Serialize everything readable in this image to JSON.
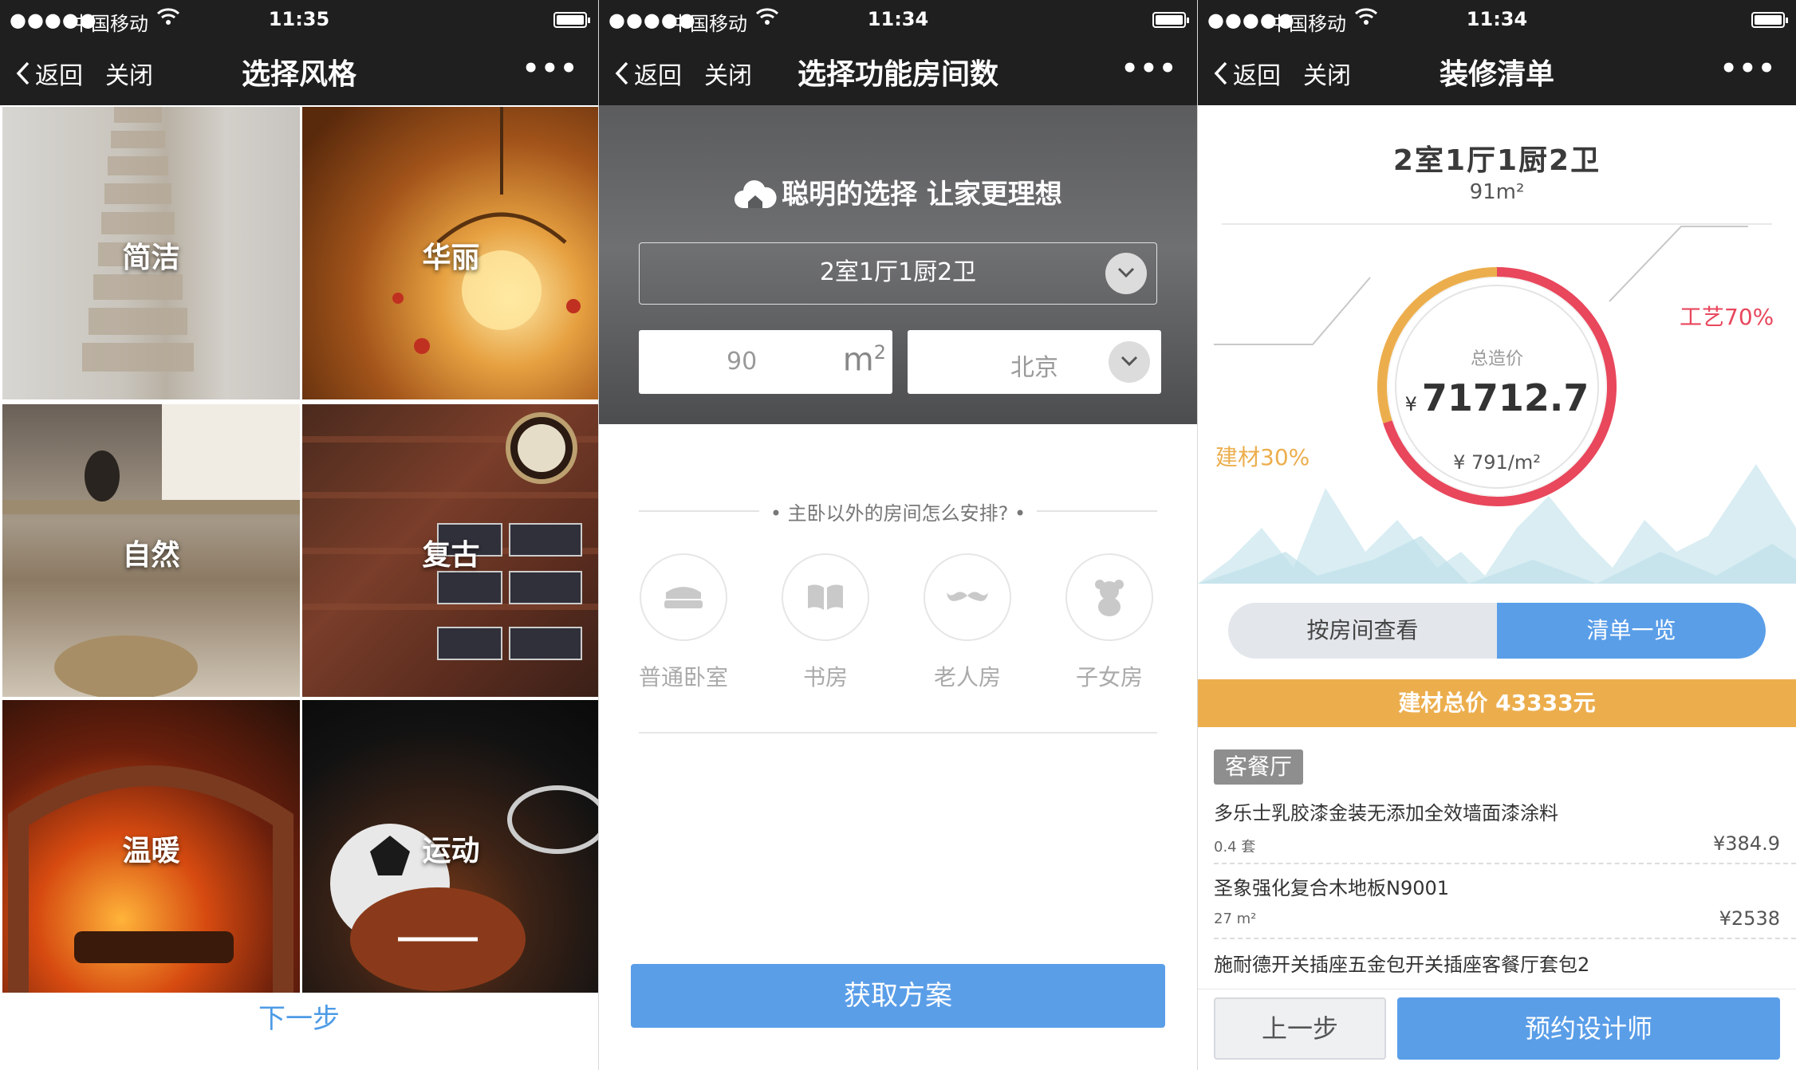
{
  "status_bars": [
    {
      "signal": "●●●●●",
      "carrier": "中国移动",
      "time": "11:35"
    },
    {
      "signal": "●●●●●",
      "carrier": "中国移动",
      "time": "11:34"
    },
    {
      "signal": "●●●●●",
      "carrier": "中国移动",
      "time": "11:34"
    }
  ],
  "nav": {
    "back": "返回",
    "close": "关闭",
    "more": "•••"
  },
  "screen1": {
    "title": "选择风格",
    "styles": [
      "简洁",
      "华丽",
      "自然",
      "复古",
      "温暖",
      "运动"
    ],
    "next": "下一步"
  },
  "screen2": {
    "title": "选择功能房间数",
    "slogan": "聪明的选择 让家更理想",
    "layout_select": "2室1厅1厨2卫",
    "area_value": "90",
    "area_unit": "m",
    "area_unit_sup": "2",
    "city": "北京",
    "question": "• 主卧以外的房间怎么安排? •",
    "rooms": [
      "普通卧室",
      "书房",
      "老人房",
      "子女房"
    ],
    "submit": "获取方案"
  },
  "screen3": {
    "title": "装修清单",
    "layout": "2室1厅1厨2卫",
    "area": "91m²",
    "total_label": "总造价",
    "currency": "¥",
    "total_value": "71712.7",
    "unit_price": "¥ 791/m²",
    "craft_label": "工艺70%",
    "material_label": "建材30%",
    "craft_share": 0.7,
    "material_share": 0.3,
    "tab_by_room": "按房间查看",
    "tab_list": "清单一览",
    "material_total": "建材总价   43333元",
    "category": "客餐厅",
    "items": [
      {
        "name": "多乐士乳胶漆金装无添加全效墙面漆涂料",
        "qty": "0.4 套",
        "price": "¥384.9"
      },
      {
        "name": "圣象强化复合木地板N9001",
        "qty": "27 m²",
        "price": "¥2538"
      },
      {
        "name": "施耐德开关插座五金包开关插座客餐厅套包2",
        "qty": "",
        "price": ""
      }
    ],
    "prev": "上一步",
    "book": "预约设计师"
  },
  "colors": {
    "accent_blue": "#5a9ee8",
    "craft_red": "#e8475c",
    "material_orange": "#ecae4d",
    "bar_dark": "#1f1f1f"
  },
  "icons": [
    "chevron-left-icon",
    "wifi-icon",
    "battery-icon",
    "cloud-home-icon",
    "chevron-down-icon",
    "bed-icon",
    "book-icon",
    "mustache-icon",
    "teddy-bear-icon"
  ]
}
